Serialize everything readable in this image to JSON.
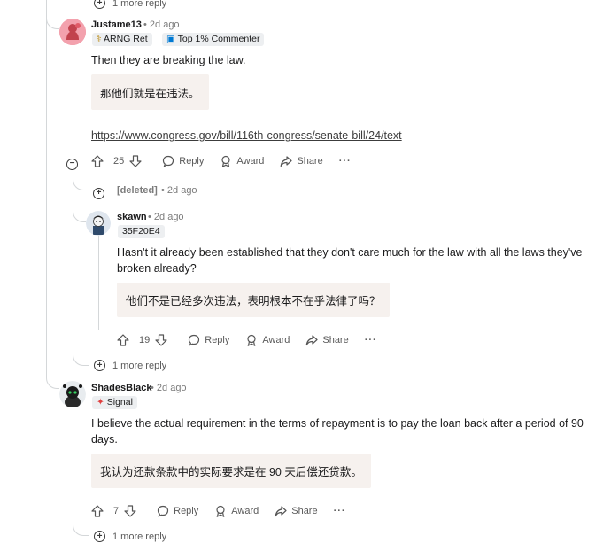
{
  "more_reply_label": "1 more reply",
  "actions": {
    "reply": "Reply",
    "award": "Award",
    "share": "Share",
    "more": "···"
  },
  "comments": [
    {
      "username": "Justame13",
      "time": "• 2d ago",
      "flairs": [
        "ARNG Ret",
        "Top 1% Commenter"
      ],
      "body": "Then they are breaking the law.",
      "translation": "那他们就是在违法。",
      "link": "https://www.congress.gov/bill/116th-congress/senate-bill/24/text",
      "votes": "25"
    },
    {
      "username": "[deleted]",
      "time": "• 2d ago"
    },
    {
      "username": "skawn",
      "time": "• 2d ago",
      "flairs": [
        "35F20E4"
      ],
      "body": "Hasn't it already been established that they don't care much for the law with all the laws they've broken already?",
      "translation": "他们不是已经多次违法，表明根本不在乎法律了吗？",
      "votes": "19"
    },
    {
      "username": "ShadesBlack",
      "time": "• 2d ago",
      "flairs": [
        "Signal"
      ],
      "body": "I believe the actual requirement in the terms of repayment is to pay the loan back after a period of 90 days.",
      "translation": "我认为还款条款中的实际要求是在 90 天后偿还贷款。",
      "votes": "7"
    }
  ]
}
